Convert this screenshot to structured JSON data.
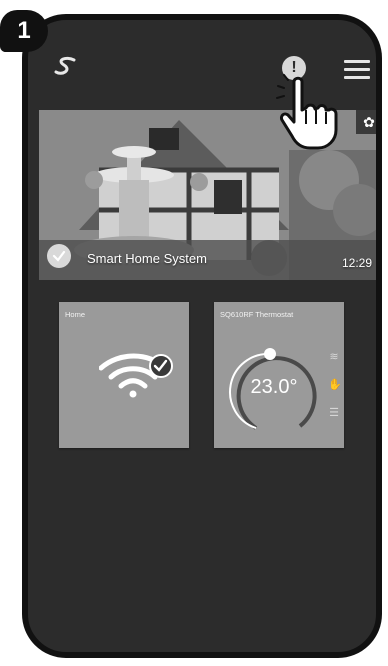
{
  "step": {
    "number": "1"
  },
  "topbar": {
    "logo_icon": "salus-logo-icon",
    "alert_icon": "exclamation-icon",
    "alert_text": "!",
    "menu_icon": "hamburger-menu-icon",
    "pointer_icon": "pointing-hand-icon"
  },
  "hero": {
    "title": "Smart Home System",
    "time": "12:29",
    "settings_icon": "gear-icon",
    "status_icon": "check-circle-icon"
  },
  "tiles": [
    {
      "label": "Home",
      "icon": "wifi-icon",
      "status_icon": "check-badge-icon"
    },
    {
      "label": "SQ610RF Thermostat",
      "temperature": "23.0°",
      "icons": [
        "heat-waves-icon",
        "hand-manual-icon",
        "radiator-icon"
      ]
    }
  ],
  "colors": {
    "background": "#2c2c2c",
    "tile": "#9a9a9a",
    "frame": "#111111",
    "text": "#ffffff"
  }
}
